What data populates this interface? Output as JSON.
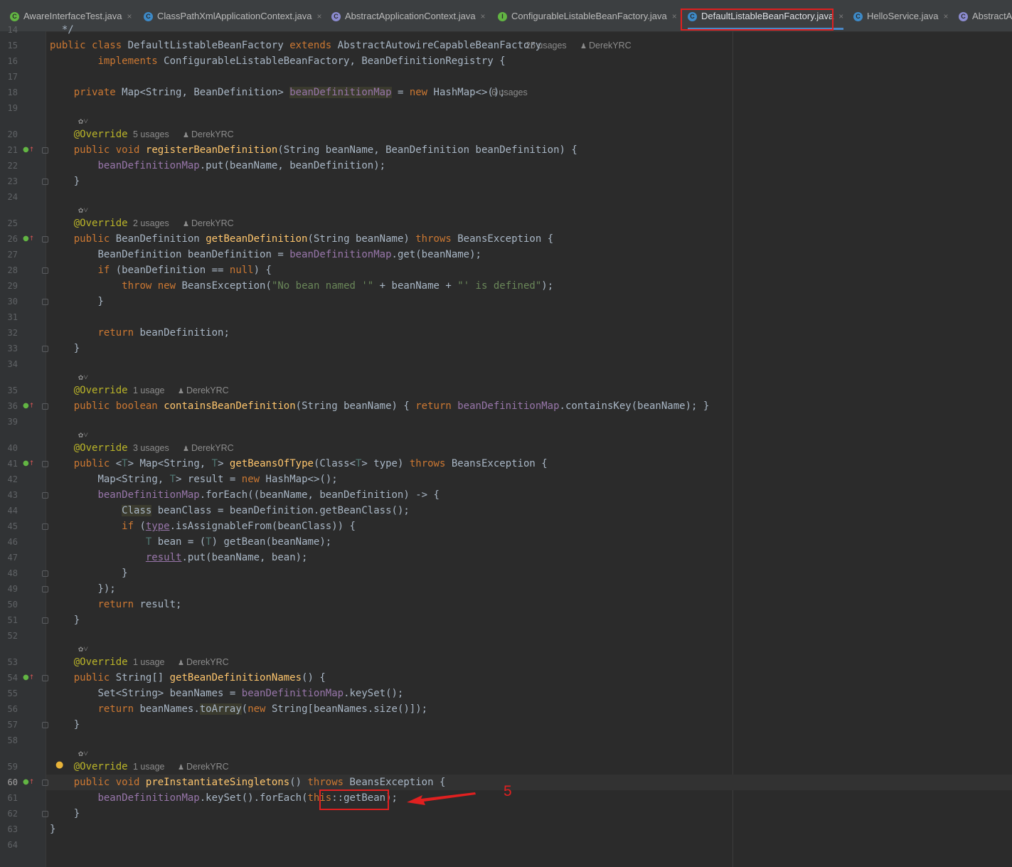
{
  "tabs": [
    {
      "label": "AwareInterfaceTest.java",
      "icon": "C",
      "color": "#62b543"
    },
    {
      "label": "ClassPathXmlApplicationContext.java",
      "icon": "C",
      "color": "#3d8ac8"
    },
    {
      "label": "AbstractApplicationContext.java",
      "icon": "C",
      "color": "#8b8bcf"
    },
    {
      "label": "ConfigurableListableBeanFactory.java",
      "icon": "I",
      "color": "#62b543"
    },
    {
      "label": "DefaultListableBeanFactory.java",
      "icon": "C",
      "color": "#3d8ac8"
    },
    {
      "label": "HelloService.java",
      "icon": "C",
      "color": "#3d8ac8"
    },
    {
      "label": "AbstractA",
      "icon": "C",
      "color": "#8b8bcf"
    }
  ],
  "tab_close": "×",
  "annotation_label": "5",
  "lines": [
    {
      "n": "14",
      "code": "  */"
    },
    {
      "n": "15",
      "code": "public class DefaultListableBeanFactory extends AbstractAutowireCapableBeanFactory",
      "hint": "25 usages",
      "author": "DerekYRC"
    },
    {
      "n": "16",
      "code": "        implements ConfigurableListableBeanFactory, BeanDefinitionRegistry {"
    },
    {
      "n": "17",
      "code": ""
    },
    {
      "n": "18",
      "code": "    private Map<String, BeanDefinition> beanDefinitionMap = new HashMap<>();",
      "hint": "6 usages"
    },
    {
      "n": "19",
      "code": ""
    },
    {
      "n": "20",
      "code": "    @Override",
      "hint": "5 usages",
      "author": "DerekYRC"
    },
    {
      "n": "21",
      "code": "    public void registerBeanDefinition(String beanName, BeanDefinition beanDefinition) {"
    },
    {
      "n": "22",
      "code": "        beanDefinitionMap.put(beanName, beanDefinition);"
    },
    {
      "n": "23",
      "code": "    }"
    },
    {
      "n": "24",
      "code": ""
    },
    {
      "n": "25",
      "code": "    @Override",
      "hint": "2 usages",
      "author": "DerekYRC"
    },
    {
      "n": "26",
      "code": "    public BeanDefinition getBeanDefinition(String beanName) throws BeansException {"
    },
    {
      "n": "27",
      "code": "        BeanDefinition beanDefinition = beanDefinitionMap.get(beanName);"
    },
    {
      "n": "28",
      "code": "        if (beanDefinition == null) {"
    },
    {
      "n": "29",
      "code": "            throw new BeansException(\"No bean named '\" + beanName + \"' is defined\");"
    },
    {
      "n": "30",
      "code": "        }"
    },
    {
      "n": "31",
      "code": ""
    },
    {
      "n": "32",
      "code": "        return beanDefinition;"
    },
    {
      "n": "33",
      "code": "    }"
    },
    {
      "n": "34",
      "code": ""
    },
    {
      "n": "35",
      "code": "    @Override",
      "hint": "1 usage",
      "author": "DerekYRC"
    },
    {
      "n": "36",
      "code": "    public boolean containsBeanDefinition(String beanName) { return beanDefinitionMap.containsKey(beanName); }"
    },
    {
      "n": "39",
      "code": ""
    },
    {
      "n": "40",
      "code": "    @Override",
      "hint": "3 usages",
      "author": "DerekYRC"
    },
    {
      "n": "41",
      "code": "    public <T> Map<String, T> getBeansOfType(Class<T> type) throws BeansException {"
    },
    {
      "n": "42",
      "code": "        Map<String, T> result = new HashMap<>();"
    },
    {
      "n": "43",
      "code": "        beanDefinitionMap.forEach((beanName, beanDefinition) -> {"
    },
    {
      "n": "44",
      "code": "            Class beanClass = beanDefinition.getBeanClass();"
    },
    {
      "n": "45",
      "code": "            if (type.isAssignableFrom(beanClass)) {"
    },
    {
      "n": "46",
      "code": "                T bean = (T) getBean(beanName);"
    },
    {
      "n": "47",
      "code": "                result.put(beanName, bean);"
    },
    {
      "n": "48",
      "code": "            }"
    },
    {
      "n": "49",
      "code": "        });"
    },
    {
      "n": "50",
      "code": "        return result;"
    },
    {
      "n": "51",
      "code": "    }"
    },
    {
      "n": "52",
      "code": ""
    },
    {
      "n": "53",
      "code": "    @Override",
      "hint": "1 usage",
      "author": "DerekYRC"
    },
    {
      "n": "54",
      "code": "    public String[] getBeanDefinitionNames() {"
    },
    {
      "n": "55",
      "code": "        Set<String> beanNames = beanDefinitionMap.keySet();"
    },
    {
      "n": "56",
      "code": "        return beanNames.toArray(new String[beanNames.size()]);"
    },
    {
      "n": "57",
      "code": "    }"
    },
    {
      "n": "58",
      "code": ""
    },
    {
      "n": "59",
      "code": "    @Override",
      "hint": "1 usage",
      "author": "DerekYRC"
    },
    {
      "n": "60",
      "code": "    public void preInstantiateSingletons() throws BeansException {"
    },
    {
      "n": "61",
      "code": "        beanDefinitionMap.keySet().forEach(this::getBean);"
    },
    {
      "n": "62",
      "code": "    }"
    },
    {
      "n": "63",
      "code": "}"
    },
    {
      "n": "64",
      "code": ""
    }
  ]
}
